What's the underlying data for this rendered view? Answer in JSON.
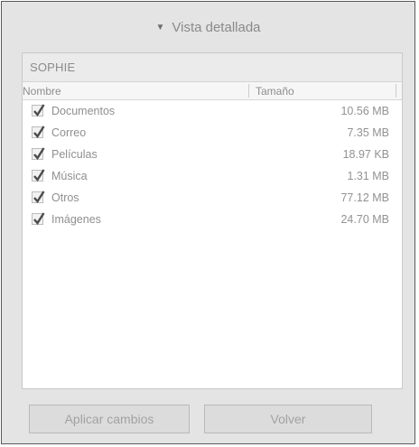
{
  "header": {
    "toggle_label": "Vista detallada"
  },
  "device": {
    "name": "SOPHIE"
  },
  "columns": {
    "name": "Nombre",
    "size": "Tamaño"
  },
  "items": [
    {
      "label": "Documentos",
      "size": "10.56 MB",
      "checked": true
    },
    {
      "label": "Correo",
      "size": "7.35 MB",
      "checked": true
    },
    {
      "label": "Películas",
      "size": "18.97 KB",
      "checked": true
    },
    {
      "label": "Música",
      "size": "1.31 MB",
      "checked": true
    },
    {
      "label": "Otros",
      "size": "77.12 MB",
      "checked": true
    },
    {
      "label": "Imágenes",
      "size": "24.70 MB",
      "checked": true
    }
  ],
  "buttons": {
    "apply": "Aplicar cambios",
    "back": "Volver"
  },
  "colors": {
    "panel_bg": "#e4e4e4",
    "list_bg": "#ffffff",
    "check": "#4a4a4a"
  }
}
